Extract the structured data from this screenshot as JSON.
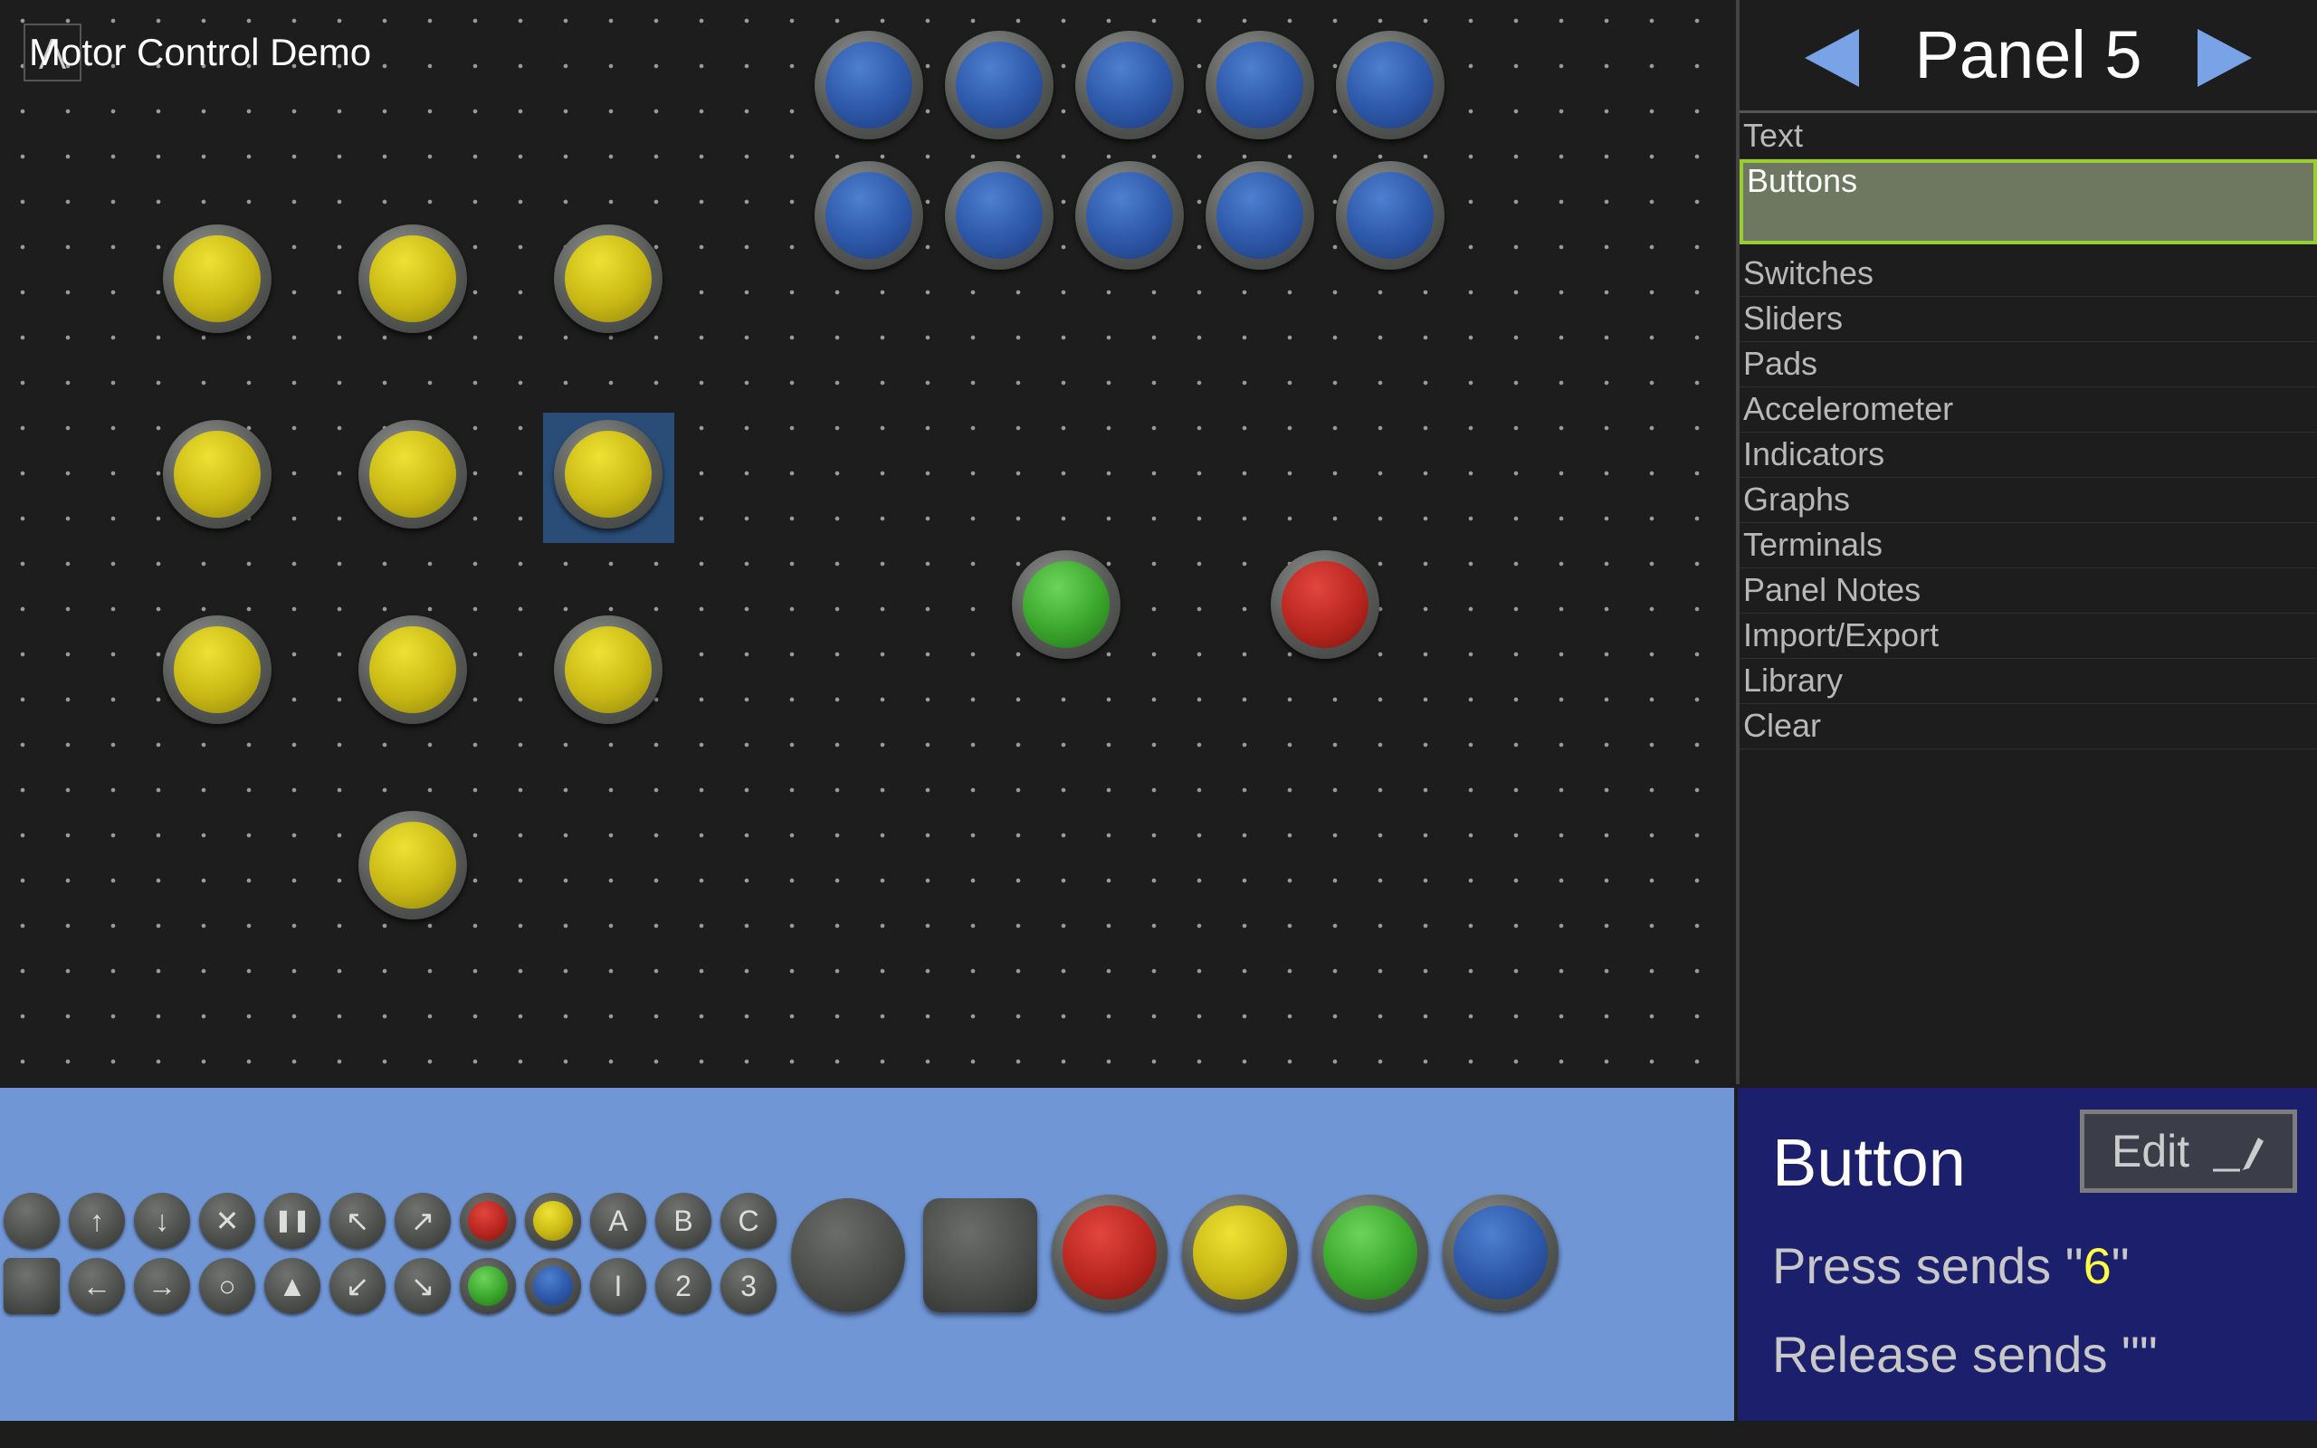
{
  "app": {
    "title": "Motor Control Demo",
    "menu_glyph": "⋀"
  },
  "panel": {
    "title": "Panel 5"
  },
  "side_menu": {
    "items": [
      "Text",
      "Buttons",
      "Switches",
      "Sliders",
      "Pads",
      "Accelerometer",
      "Indicators",
      "Graphs",
      "Terminals",
      "Panel Notes",
      "Import/Export",
      "Library",
      "Clear"
    ],
    "active": "Buttons"
  },
  "palette": {
    "row1_symbols": [
      "",
      "↑",
      "↓",
      "✕",
      "❚❚",
      "↖",
      "↗",
      "",
      "",
      "A",
      "B",
      "C"
    ],
    "row2_symbols": [
      "",
      "←",
      "→",
      "○",
      "▲",
      "↙",
      "↘",
      "",
      "",
      "I",
      "2",
      "3"
    ]
  },
  "info": {
    "title": "Button",
    "edit_label": "Edit",
    "press_prefix": "Press sends \"",
    "press_value": "6",
    "press_suffix": "\"",
    "release_label": "Release sends \"\""
  },
  "colors": {
    "yellow": "#c9b814",
    "blue": "#2d57a8",
    "green": "#3aa52c",
    "red": "#b8261f",
    "palette_bg": "#7096d6",
    "info_bg": "#1b1f6c"
  }
}
